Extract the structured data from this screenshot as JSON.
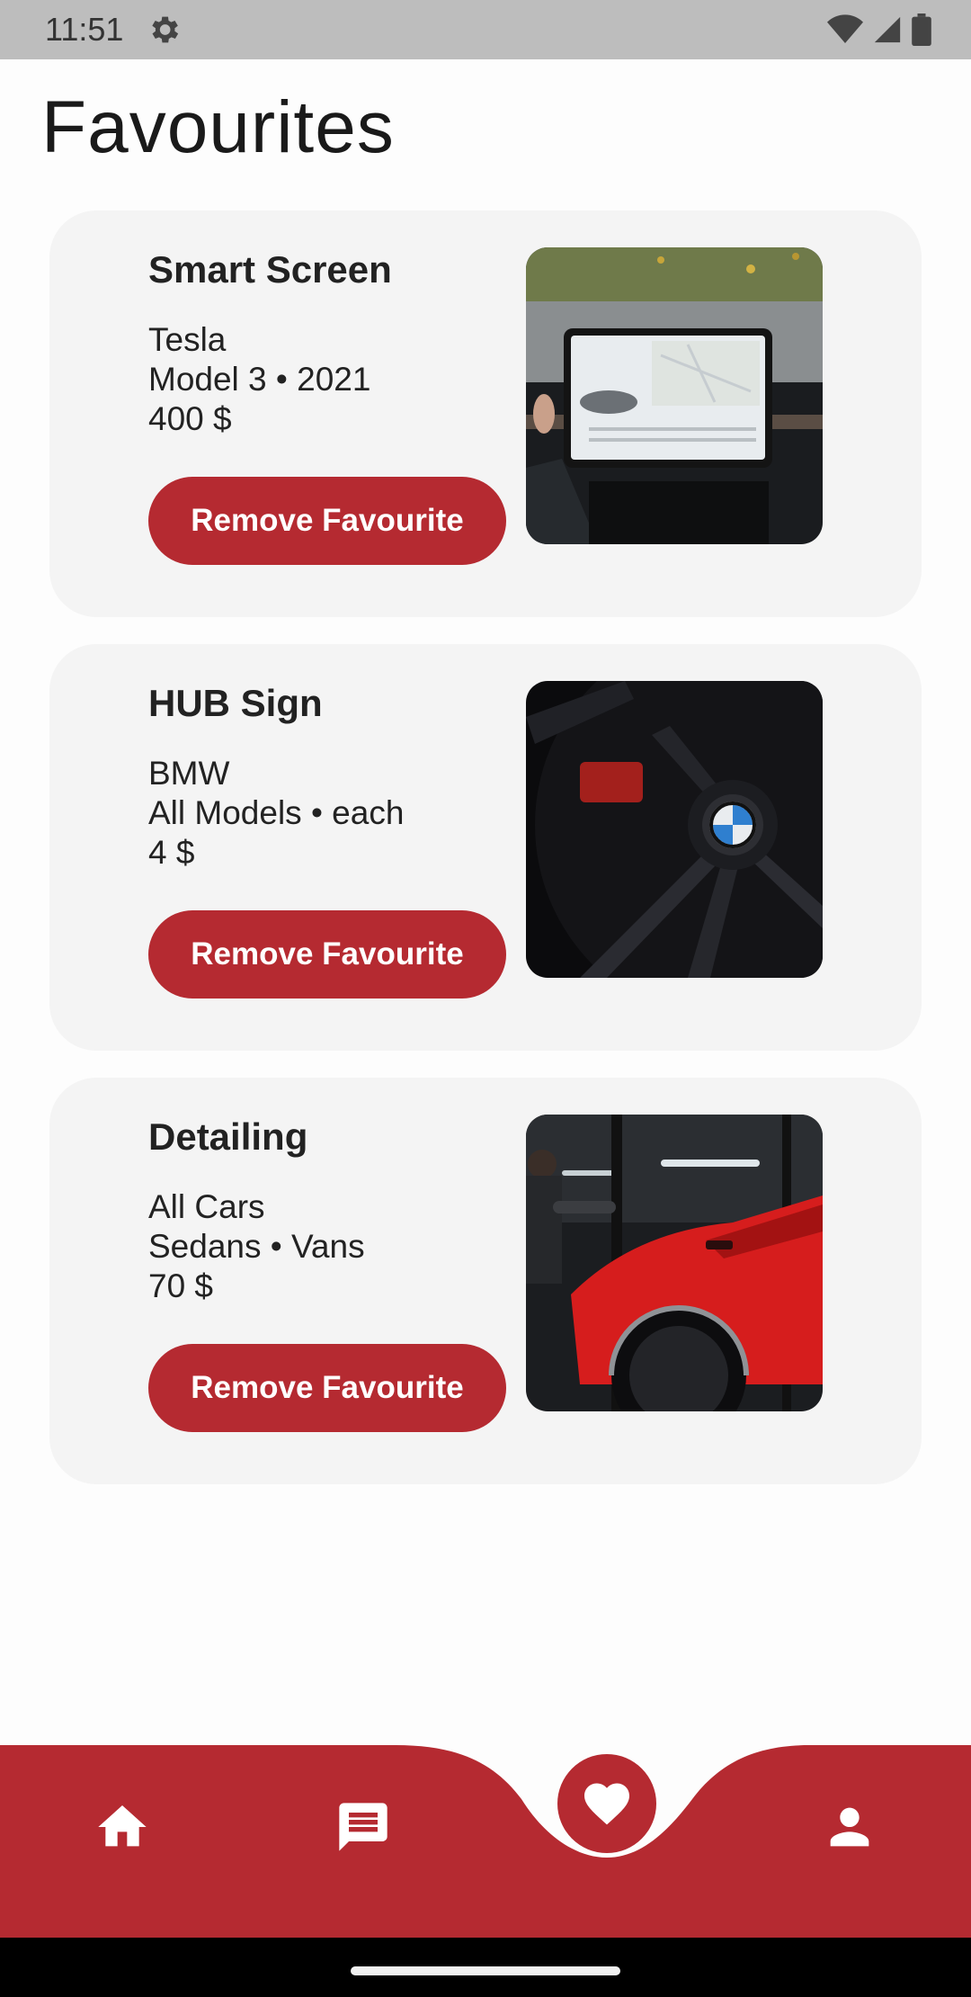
{
  "status_bar": {
    "time": "11:51"
  },
  "page": {
    "title": "Favourites"
  },
  "favourites": [
    {
      "title": "Smart Screen",
      "brand": "Tesla",
      "model_line": "Model 3 • 2021",
      "price": "400 $",
      "button_label": "Remove Favourite",
      "image": "tesla-dashboard-screen"
    },
    {
      "title": "HUB Sign",
      "brand": "BMW",
      "model_line": "All Models • each",
      "price": "4 $",
      "button_label": "Remove Favourite",
      "image": "bmw-wheel-hub"
    },
    {
      "title": "Detailing",
      "brand": "All Cars",
      "model_line": "Sedans • Vans",
      "price": "70 $",
      "button_label": "Remove Favourite",
      "image": "red-car-detailing"
    }
  ],
  "bottom_nav": {
    "items": [
      "home-icon",
      "chat-icon",
      "heart-icon",
      "person-icon"
    ],
    "active": "heart-icon"
  },
  "colors": {
    "accent": "#b52a31",
    "card_bg": "#f4f4f4",
    "status_bar": "#bdbdbd"
  }
}
